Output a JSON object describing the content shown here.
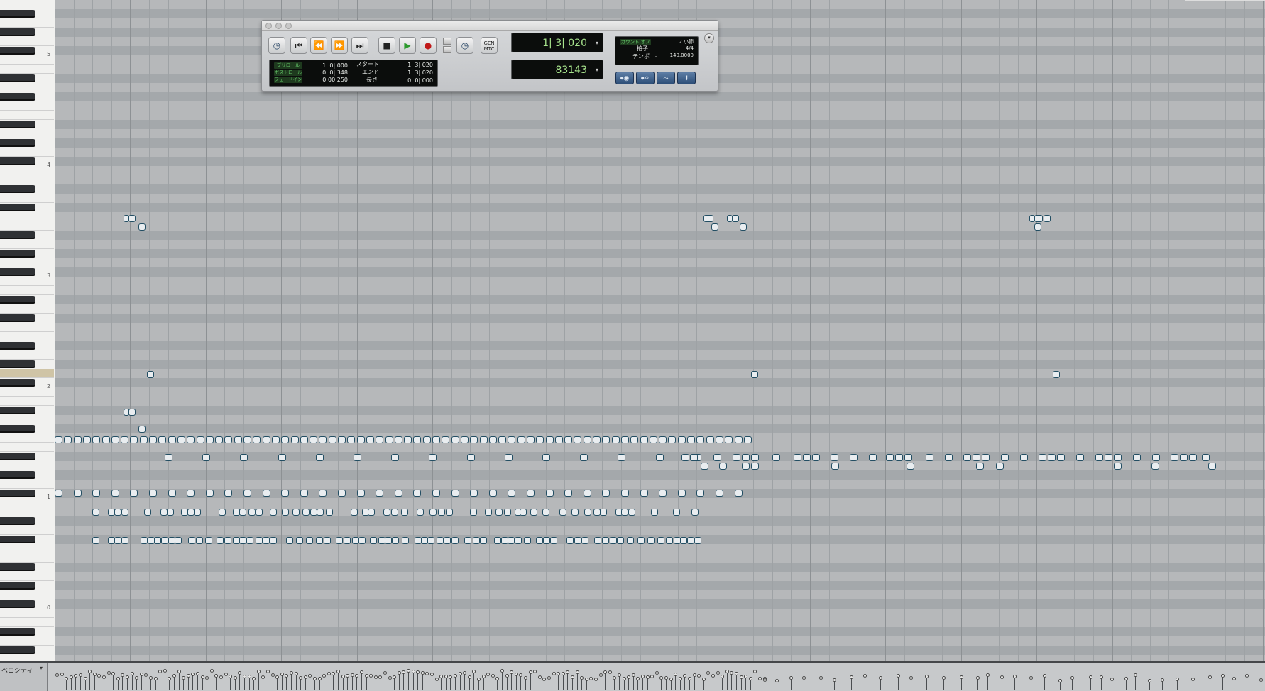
{
  "keyboard": {
    "octave_labels": [
      "5",
      "4",
      "3",
      "2",
      "1",
      "0"
    ]
  },
  "transport": {
    "buttons": [
      {
        "name": "online-button",
        "glyph": "◷"
      },
      {
        "name": "return-to-zero-button",
        "glyph": "⏮"
      },
      {
        "name": "rewind-button",
        "glyph": "⏪"
      },
      {
        "name": "fast-forward-button",
        "glyph": "⏩"
      },
      {
        "name": "go-to-end-button",
        "glyph": "⏭"
      },
      {
        "name": "stop-button",
        "glyph": "■"
      },
      {
        "name": "play-button",
        "glyph": "▶"
      },
      {
        "name": "record-button",
        "glyph": "●"
      },
      {
        "name": "online-sync-button",
        "glyph": "◷"
      }
    ],
    "gen_mtc": "GEN MTC",
    "preroll": {
      "label": "プリロール",
      "value": "1| 0| 000"
    },
    "postroll": {
      "label": "ポストロール",
      "value": "0| 0| 348"
    },
    "fadein": {
      "label": "フェードイン",
      "value": "0:00.250"
    },
    "start": {
      "label": "スタート",
      "value": "1| 3| 020"
    },
    "end": {
      "label": "エンド",
      "value": "1| 3| 020"
    },
    "length": {
      "label": "長さ",
      "value": "0| 0| 000"
    },
    "main_counter": "1| 3| 020",
    "sub_counter": "83143",
    "count_off": {
      "label": "カウント オフ",
      "value": "2 小節"
    },
    "meter": {
      "label": "拍子",
      "value": "4/4"
    },
    "tempo": {
      "label": "テンポ",
      "note_glyph": "♩",
      "value": "140.0000"
    },
    "midi_buttons": [
      "⏺◉",
      "⏺⚪",
      "⤳",
      "⬇"
    ]
  },
  "velocity": {
    "label": "ベロシティ",
    "arrow": "▾"
  }
}
